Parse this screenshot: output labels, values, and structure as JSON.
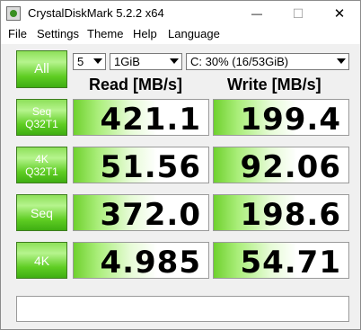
{
  "window": {
    "title": "CrystalDiskMark 5.2.2 x64",
    "minimize_glyph": "—",
    "maximize_glyph": "☐",
    "close_glyph": "✕"
  },
  "menu": [
    "File",
    "Settings",
    "Theme",
    "Help",
    "Language"
  ],
  "controls": {
    "all_label": "All",
    "count_value": "5",
    "size_value": "1GiB",
    "drive_value": "C: 30% (16/53GiB)"
  },
  "columns": {
    "read": "Read [MB/s]",
    "write": "Write [MB/s]"
  },
  "tests": [
    {
      "line1": "Seq",
      "line2": "Q32T1",
      "read": "421.1",
      "write": "199.4"
    },
    {
      "line1": "4K",
      "line2": "Q32T1",
      "read": "51.56",
      "write": "92.06"
    },
    {
      "line1": "Seq",
      "line2": "",
      "read": "372.0",
      "write": "198.6"
    },
    {
      "line1": "4K",
      "line2": "",
      "read": "4.985",
      "write": "54.71"
    }
  ],
  "comment": "",
  "colors": {
    "button_green": "#5fcd23",
    "bar_green": "#6fd12e"
  }
}
